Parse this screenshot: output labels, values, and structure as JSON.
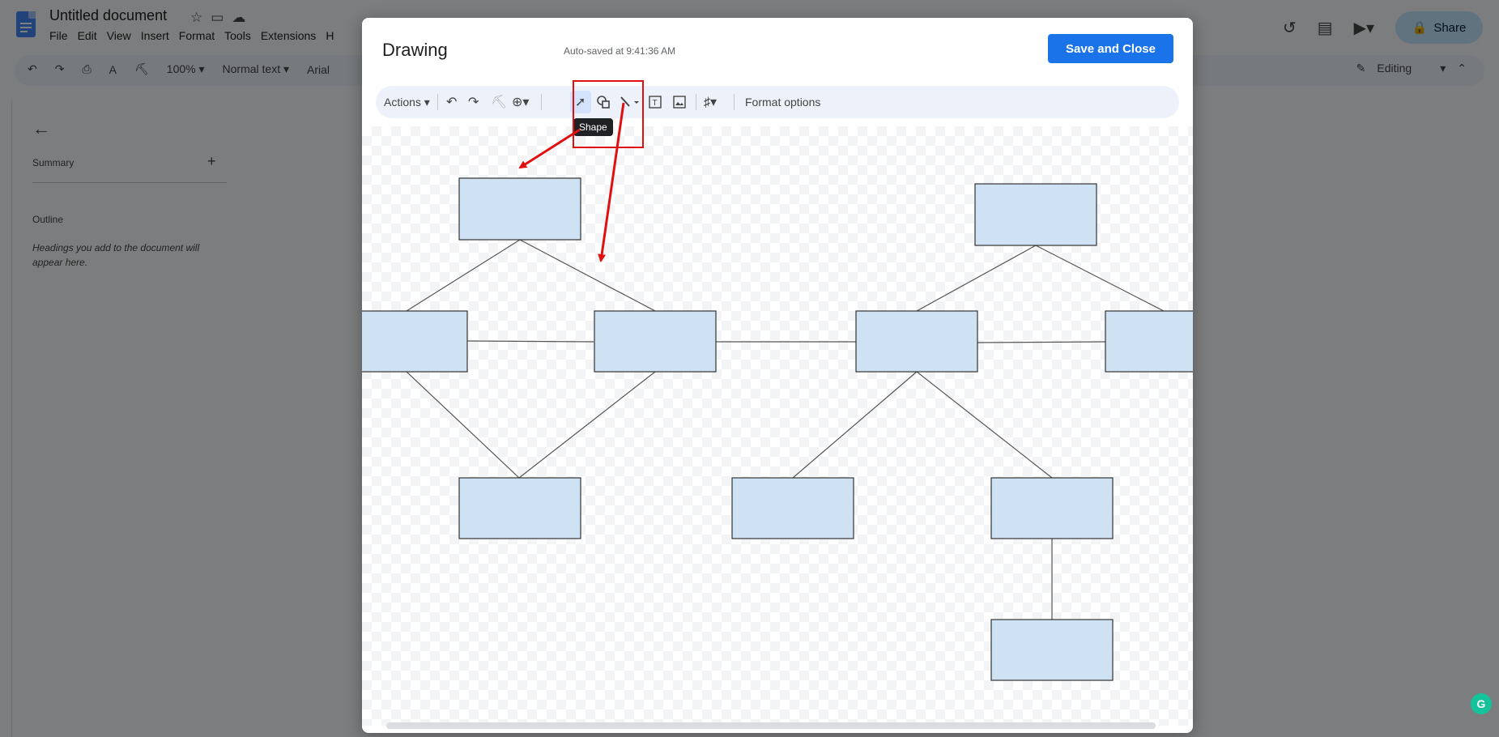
{
  "document": {
    "title": "Untitled document",
    "menu": [
      "File",
      "Edit",
      "View",
      "Insert",
      "Format",
      "Tools",
      "Extensions",
      "H"
    ]
  },
  "share": {
    "label": "Share"
  },
  "toolbar": {
    "zoom": "100%",
    "style": "Normal text",
    "font": "Arial",
    "mode": "Editing"
  },
  "sidebar": {
    "summary_label": "Summary",
    "outline_label": "Outline",
    "outline_hint": "Headings you add to the document will appear here."
  },
  "drawing": {
    "title": "Drawing",
    "autosaved": "Auto-saved at 9:41:36 AM",
    "save_close_label": "Save and Close",
    "actions_label": "Actions",
    "format_options_label": "Format options",
    "tooltip": "Shape"
  },
  "colors": {
    "shape_fill": "#cfe2f3",
    "accent": "#1a73e8",
    "annotation": "#e01010"
  },
  "icons": [
    "docs-logo-icon",
    "star-icon",
    "folder-move-icon",
    "cloud-status-icon",
    "history-icon",
    "comment-icon",
    "meet-icon",
    "lock-icon",
    "undo-icon",
    "redo-icon",
    "print-icon",
    "spellcheck-icon",
    "paint-format-icon",
    "pencil-icon",
    "chevron-up-icon",
    "back-arrow-icon",
    "plus-icon",
    "zoom-icon",
    "select-icon",
    "shape-icon",
    "line-icon",
    "textbox-icon",
    "image-icon",
    "wordart-icon",
    "grammarly-icon"
  ]
}
